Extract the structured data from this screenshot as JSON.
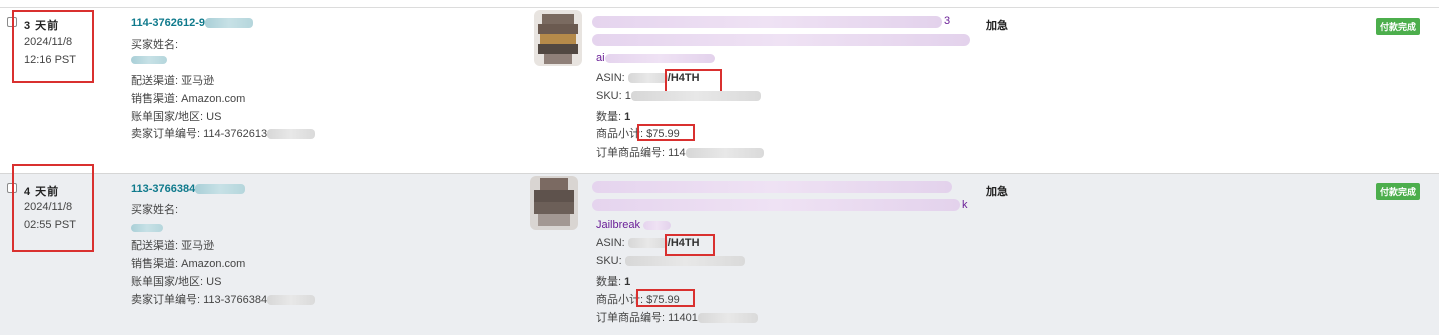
{
  "orders": [
    {
      "time_ago": "3 天前",
      "date": "2024/11/8",
      "time": "12:16 PST",
      "order_id": "114-3762612-9",
      "buyer_name_label": "买家姓名:",
      "shipping_channel": "配送渠道: 亚马逊",
      "sales_channel": "销售渠道: Amazon.com",
      "billing_country": "账单国家/地区: US",
      "seller_order_number": "卖家订单编号: 114-3762613",
      "title_visible_fragment": "3",
      "title_line3": "ai",
      "asin_label": "ASIN: ",
      "asin_suffix": "/H4TH",
      "sku_label": "SKU: 1",
      "quantity_label": "数量: ",
      "quantity": "1",
      "subtotal_label": "商品小计: ",
      "subtotal": "$75.99",
      "order_item_number": "订单商品编号: 114",
      "flag": "加急",
      "status": "付款完成"
    },
    {
      "time_ago": "4 天前",
      "date": "2024/11/8",
      "time": "02:55 PST",
      "order_id": "113-3766384",
      "buyer_name_label": "买家姓名:",
      "shipping_channel": "配送渠道: 亚马逊",
      "sales_channel": "销售渠道: Amazon.com",
      "billing_country": "账单国家/地区: US",
      "seller_order_number": "卖家订单编号: 113-3766384",
      "title_visible_fragment": "k",
      "title_line3": "Jailbreak ",
      "asin_label": "ASIN: ",
      "asin_suffix": "/H4TH",
      "sku_label": "SKU: ",
      "quantity_label": "数量: ",
      "quantity": "1",
      "subtotal_label": "商品小计: ",
      "subtotal": "$75.99",
      "order_item_number": "订单商品编号: 11401",
      "flag": "加急",
      "status": "付款完成"
    }
  ],
  "colors": {
    "order_link": "#0f7a8c",
    "title_link": "#6a1f97",
    "status_badge": "#4cae4c",
    "highlight_box": "#d9302f",
    "alt_row_bg": "#eceef1"
  }
}
